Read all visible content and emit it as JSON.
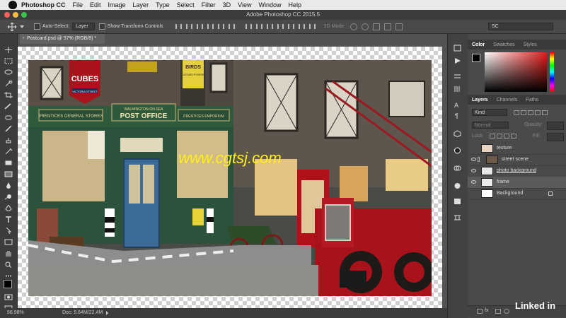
{
  "menubar": {
    "app_name": "Photoshop CC",
    "items": [
      "File",
      "Edit",
      "Image",
      "Layer",
      "Type",
      "Select",
      "Filter",
      "3D",
      "View",
      "Window",
      "Help"
    ]
  },
  "window": {
    "title": "Adobe Photoshop CC 2015.5"
  },
  "options": {
    "auto_select_label": "Auto-Select:",
    "auto_select_value": "Layer",
    "show_transform_label": "Show Transform Controls",
    "mode_3d_label": "3D Mode:",
    "workspace_value": "SC"
  },
  "document": {
    "tab_title": "Postcard.psd @ 57% (RGB/8) *"
  },
  "canvas": {
    "watermark": "www.cgtsj.com",
    "signs": {
      "cubes": "CUBES",
      "victoria": "VICTORIA STREET",
      "birds": "BIRDS",
      "birds_sub": "CUSTARD POWDER",
      "general": "PRENTICES GENERAL STORES",
      "town": "WALMINGTON-ON-SEA",
      "post_office": "POST OFFICE",
      "emporium": "PRENTICES EMPORIUM"
    }
  },
  "status": {
    "zoom": "56.98%",
    "doc": "Doc: 5.64M/22.4M"
  },
  "color_panel": {
    "tabs": [
      "Color",
      "Swatches",
      "Styles"
    ]
  },
  "layers_panel": {
    "tabs": [
      "Layers",
      "Channels",
      "Paths"
    ],
    "kind_label": "Kind",
    "blend_mode": "Normal",
    "opacity_label": "Opacity:",
    "lock_label": "Lock:",
    "fill_label": "Fill:",
    "layers": [
      {
        "name": "texture",
        "visible": false,
        "thumb_color": "#e8d6c2"
      },
      {
        "name": "street scene",
        "visible": true,
        "thumb_color": "#6b5a4a"
      },
      {
        "name": "photo background",
        "visible": true,
        "thumb_color": "#e6e6e6"
      },
      {
        "name": "frame",
        "visible": true,
        "thumb_color": "#ececec"
      },
      {
        "name": "Background",
        "visible": false,
        "thumb_color": "#ffffff"
      }
    ]
  },
  "branding": {
    "logo": "Linked in"
  },
  "colors": {
    "accent_yellow": "#ffef1a",
    "fire_engine": "#b0121a",
    "door_blue": "#3d6b97"
  }
}
